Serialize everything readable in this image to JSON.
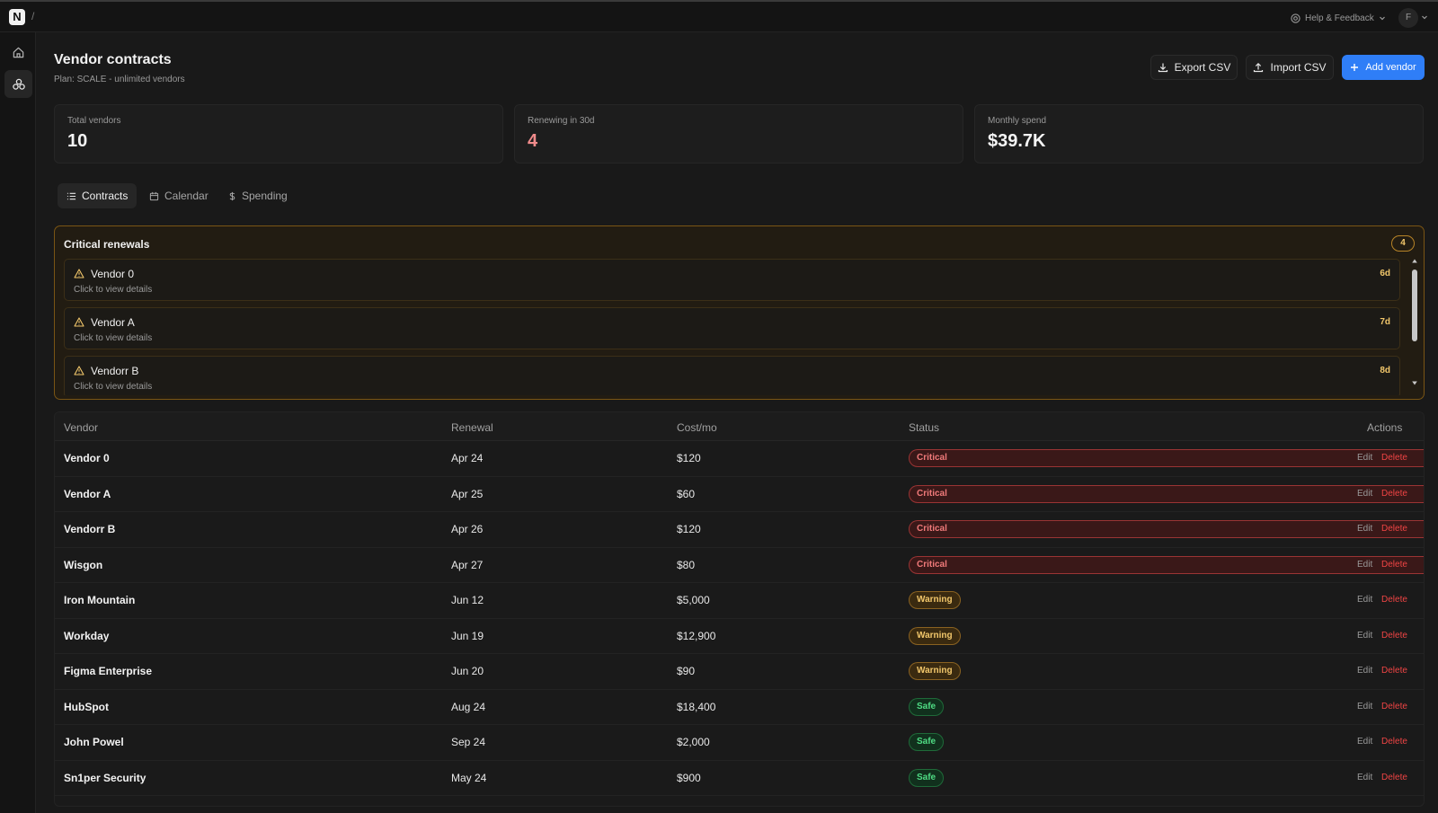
{
  "topbar": {
    "logo": "N",
    "breadcrumb_sep": "/",
    "help_label": "Help & Feedback",
    "avatar_initial": "F"
  },
  "sidebar": {
    "items": [
      {
        "icon": "home-icon",
        "active": false
      },
      {
        "icon": "vendors-icon",
        "active": true
      }
    ]
  },
  "header": {
    "title": "Vendor contracts",
    "subtitle": "Plan: SCALE - unlimited vendors",
    "export_label": "Export CSV",
    "import_label": "Import CSV",
    "add_label": "Add vendor"
  },
  "stats": [
    {
      "label": "Total vendors",
      "value": "10"
    },
    {
      "label": "Renewing in 30d",
      "value": "4"
    },
    {
      "label": "Monthly spend",
      "value": "$39.7K"
    }
  ],
  "tabs": [
    {
      "label": "Contracts",
      "icon": "list-icon",
      "active": true
    },
    {
      "label": "Calendar",
      "icon": "calendar-icon",
      "active": false
    },
    {
      "label": "Spending",
      "icon": "dollar-icon",
      "active": false
    }
  ],
  "critical": {
    "title": "Critical renewals",
    "count": "4",
    "items": [
      {
        "name": "Vendor 0",
        "hint": "Click to view details",
        "days": "6d"
      },
      {
        "name": "Vendor A",
        "hint": "Click to view details",
        "days": "7d"
      },
      {
        "name": "Vendorr B",
        "hint": "Click to view details",
        "days": "8d"
      }
    ]
  },
  "table": {
    "columns": {
      "vendor": "Vendor",
      "renewal": "Renewal",
      "cost": "Cost/mo",
      "status": "Status",
      "actions": "Actions"
    },
    "edit_label": "Edit",
    "delete_label": "Delete",
    "rows": [
      {
        "vendor": "Vendor 0",
        "renewal": "Apr 24",
        "cost": "$120",
        "status": "Critical",
        "level": "critical"
      },
      {
        "vendor": "Vendor A",
        "renewal": "Apr 25",
        "cost": "$60",
        "status": "Critical",
        "level": "critical"
      },
      {
        "vendor": "Vendorr B",
        "renewal": "Apr 26",
        "cost": "$120",
        "status": "Critical",
        "level": "critical"
      },
      {
        "vendor": "Wisgon",
        "renewal": "Apr 27",
        "cost": "$80",
        "status": "Critical",
        "level": "critical"
      },
      {
        "vendor": "Iron Mountain",
        "renewal": "Jun 12",
        "cost": "$5,000",
        "status": "Warning",
        "level": "warning"
      },
      {
        "vendor": "Workday",
        "renewal": "Jun 19",
        "cost": "$12,900",
        "status": "Warning",
        "level": "warning"
      },
      {
        "vendor": "Figma Enterprise",
        "renewal": "Jun 20",
        "cost": "$90",
        "status": "Warning",
        "level": "warning"
      },
      {
        "vendor": "HubSpot",
        "renewal": "Aug 24",
        "cost": "$18,400",
        "status": "Safe",
        "level": "safe"
      },
      {
        "vendor": "John Powel",
        "renewal": "Sep 24",
        "cost": "$2,000",
        "status": "Safe",
        "level": "safe"
      },
      {
        "vendor": "Sn1per Security",
        "renewal": "May 24",
        "cost": "$900",
        "status": "Safe",
        "level": "safe"
      }
    ]
  },
  "colors": {
    "background": "#191919",
    "accent": "#2f7ef7",
    "critical": "#f07a7a",
    "warning": "#f2c76b",
    "safe": "#4fdc84",
    "delete": "#ef4444"
  }
}
